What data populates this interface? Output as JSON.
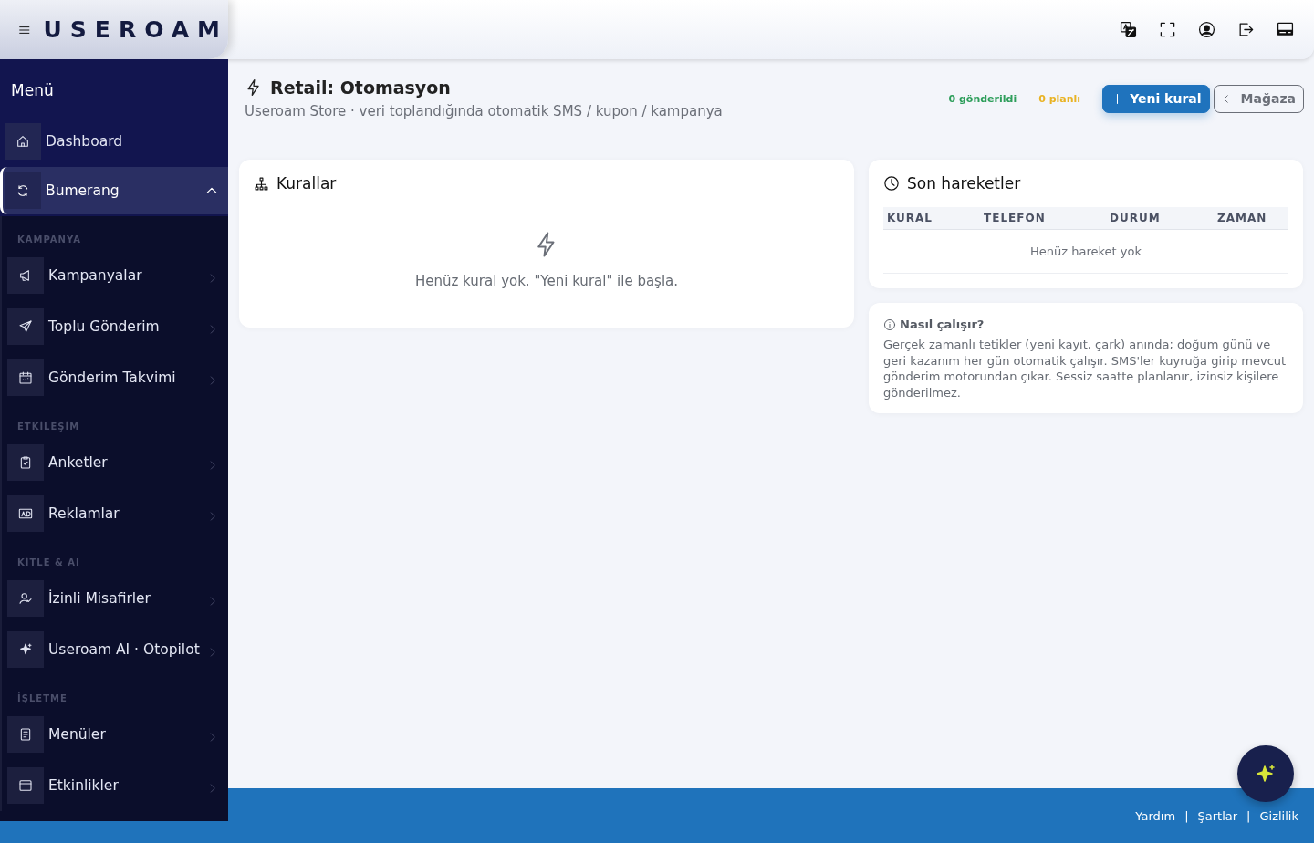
{
  "header": {
    "brand": "USEROAM"
  },
  "sidebar": {
    "title": "Menü",
    "items": [
      {
        "kind": "link",
        "label": "Dashboard",
        "selected": false
      },
      {
        "kind": "group",
        "label": "Bumerang",
        "selected": true,
        "expanded": true
      },
      {
        "kind": "section",
        "label": "KAMPANYA"
      },
      {
        "kind": "item",
        "label": "Kampanyalar"
      },
      {
        "kind": "item",
        "label": "Toplu Gönderim"
      },
      {
        "kind": "item",
        "label": "Gönderim Takvimi"
      },
      {
        "kind": "section",
        "label": "ETKİLEŞİM"
      },
      {
        "kind": "item",
        "label": "Anketler"
      },
      {
        "kind": "item",
        "label": "Reklamlar"
      },
      {
        "kind": "section",
        "label": "KİTLE & AI"
      },
      {
        "kind": "item",
        "label": "İzinli Misafirler"
      },
      {
        "kind": "item",
        "label": "Useroam AI · Otopilot"
      },
      {
        "kind": "section",
        "label": "İŞLETME"
      },
      {
        "kind": "item",
        "label": "Menüler"
      },
      {
        "kind": "item",
        "label": "Etkinlikler"
      }
    ]
  },
  "page": {
    "title": "Retail: Otomasyon",
    "subtitle": "Useroam Store · veri toplandığında otomatik SMS / kupon / kampanya",
    "stats": [
      {
        "label": "0 gönderildi",
        "color": "#2e9e5b"
      },
      {
        "label": "0 planlı",
        "color": "#e9b324"
      }
    ],
    "buttons": [
      {
        "kind": "primary",
        "label": "Yeni kural"
      },
      {
        "kind": "outline",
        "label": "Mağaza"
      }
    ]
  },
  "rules_card": {
    "title": "Kurallar",
    "empty_text": "Henüz kural yok. \"Yeni kural\" ile başla."
  },
  "activity_card": {
    "title": "Son hareketler",
    "columns": [
      "KURAL",
      "TELEFON",
      "DURUM",
      "ZAMAN"
    ],
    "empty_text": "Henüz hareket yok"
  },
  "info_card": {
    "title": "Nasıl çalışır?",
    "text": "Gerçek zamanlı tetikler (yeni kayıt, çark) anında; doğum günü ve geri kazanım her gün otomatik çalışır. SMS'ler kuyruğa girip mevcut gönderim motorundan çıkar. Sessiz saatte planlanır, izinsiz kişilere gönderilmez."
  },
  "footer": {
    "links": [
      "Yardım",
      "Şartlar",
      "Gizlilik"
    ],
    "separators": [
      "|",
      "|"
    ]
  }
}
